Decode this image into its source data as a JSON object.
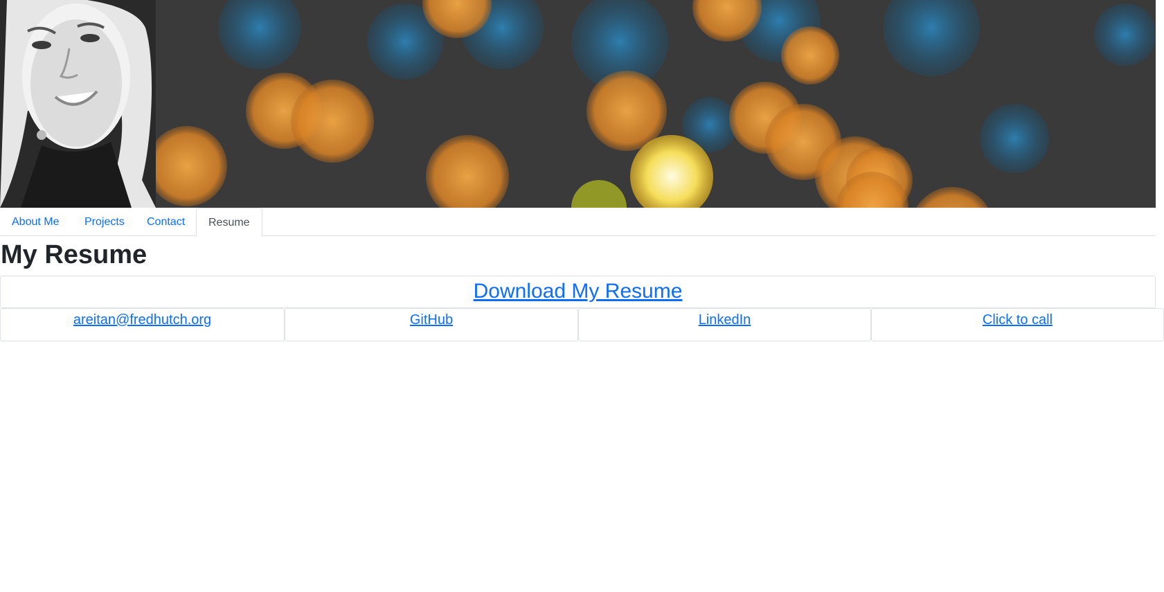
{
  "nav": {
    "tabs": [
      {
        "label": "About Me",
        "active": false
      },
      {
        "label": "Projects",
        "active": false
      },
      {
        "label": "Contact",
        "active": false
      },
      {
        "label": "Resume",
        "active": true
      }
    ]
  },
  "main": {
    "title": "My Resume",
    "download_label": "Download My Resume",
    "contact_links": [
      {
        "label": "areitan@fredhutch.org"
      },
      {
        "label": "GitHub"
      },
      {
        "label": "LinkedIn"
      },
      {
        "label": "Click to call"
      }
    ]
  },
  "colors": {
    "link": "#0d6efd",
    "text": "#212529",
    "border": "#dee2e6",
    "banner_bg": "#3a3a3a",
    "bokeh_orange": "#e08a2c",
    "bokeh_blue": "#1f7fb8"
  }
}
